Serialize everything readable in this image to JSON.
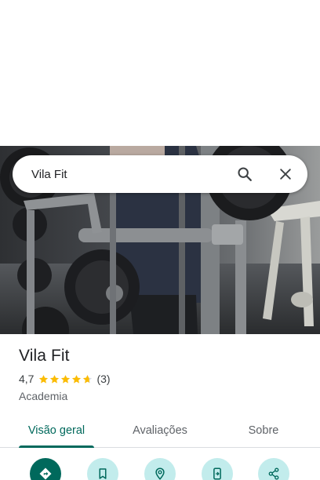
{
  "search": {
    "value": "Vila Fit",
    "search_icon": "search-icon",
    "close_icon": "close-icon"
  },
  "place": {
    "title": "Vila Fit",
    "rating_value": "4,7",
    "rating_numeric": 4.7,
    "stars_max": 5,
    "review_count": "(3)",
    "category": "Academia"
  },
  "tabs": [
    {
      "label": "Visão geral",
      "active": true
    },
    {
      "label": "Avaliações",
      "active": false
    },
    {
      "label": "Sobre",
      "active": false
    }
  ],
  "actions": [
    {
      "icon": "directions-icon"
    },
    {
      "icon": "bookmark-icon"
    },
    {
      "icon": "nearby-icon"
    },
    {
      "icon": "send-to-phone-icon"
    },
    {
      "icon": "share-icon"
    }
  ],
  "colors": {
    "accent": "#00695c",
    "action_secondary_bg": "#c2ecec",
    "star": "#fbbc04",
    "text_primary": "#202124",
    "text_secondary": "#5f6368"
  }
}
